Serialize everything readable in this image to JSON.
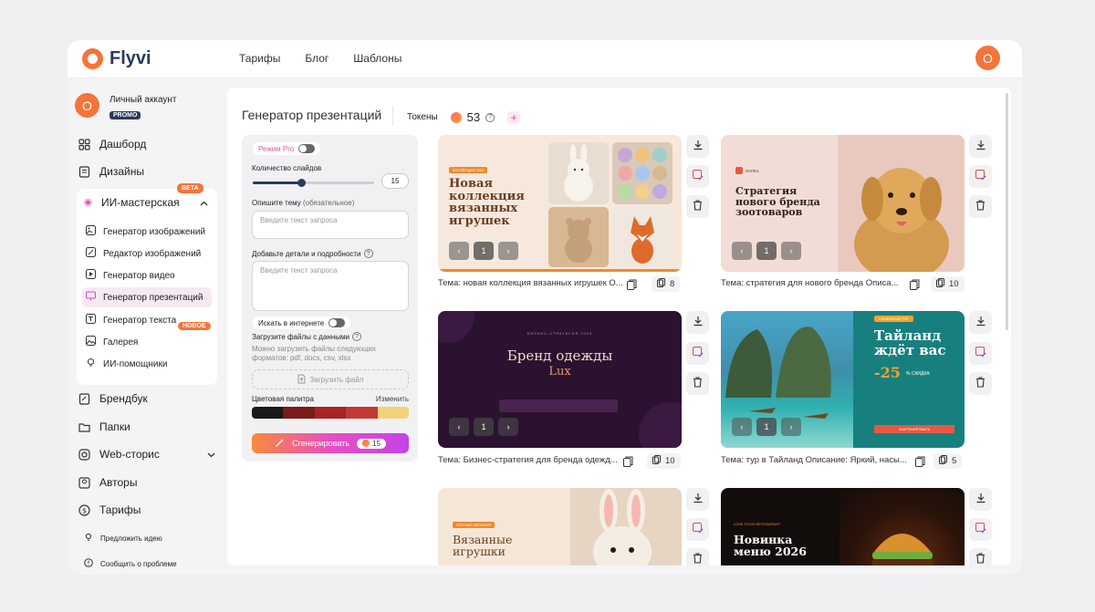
{
  "app": {
    "name": "Flyvi",
    "user_initial": "O"
  },
  "nav": [
    "Тарифы",
    "Блог",
    "Шаблоны"
  ],
  "account": {
    "name": "Личный аккаунт",
    "badge": "PROMO",
    "initial": "O"
  },
  "sidebar": {
    "dashboard": "Дашборд",
    "designs": "Дизайны",
    "ai_studio": {
      "label": "ИИ-мастерская",
      "badge": "BETA"
    },
    "sub_items": [
      "Генератор изображений",
      "Редактор изображений",
      "Генератор видео",
      "Генератор презентаций",
      "Генератор текста",
      "Галерея",
      "ИИ-помощники"
    ],
    "active_badge": "НОВОЕ",
    "brandbook": "Брендбук",
    "folders": "Папки",
    "web_stories": "Web-сторис",
    "authors": "Авторы",
    "tariffs": "Тарифы",
    "suggest": "Предложить идею",
    "report": "Сообщить о проблеме"
  },
  "header": {
    "title": "Генератор презентаций",
    "tokens_label": "Токены",
    "tokens_value": "53",
    "help": "?",
    "add": "+"
  },
  "form": {
    "pro_mode": "Режим Pro",
    "slides_label": "Количество слайдов",
    "slides_value": "15",
    "slides_fraction": 0.4,
    "topic_label": "Опишите тему",
    "topic_required": "(обязательное)",
    "topic_placeholder": "Введите текст запроса",
    "details_label": "Добавьте детали и подробности",
    "details_placeholder": "Введите текст запроса",
    "internet_label": "Искать в интернете",
    "upload_label": "Загрузите файлы с данными",
    "upload_hint": "Можно загрузить файлы следующих форматов: pdf, docs, csv, xlsx",
    "upload_button": "Загрузить файл",
    "palette_label": "Цветовая палитра",
    "palette_change": "Изменить",
    "palette": [
      "#1a1a1a",
      "#7a1a1a",
      "#a82424",
      "#c33a35",
      "#f2d27a"
    ],
    "generate": "Сгенерировать",
    "generate_cost": "15"
  },
  "cards": [
    {
      "title": "Тема: новая коллекция вязанных игрушек О...",
      "slides": "8",
      "page": "1",
      "tag": "КОЛЛЕКЦИЯ 2026",
      "heading": "Новая коллекция вязанных игрушек",
      "colors": {
        "bg": "#f6e8dc",
        "accent": "#f08a2c"
      }
    },
    {
      "title": "Тема: стратегия для нового бренда Описа...",
      "slides": "10",
      "page": "1",
      "tag": "ЛАПКА",
      "heading": "Стратегия нового бренда зоотоваров",
      "colors": {
        "bg": "#f2ddd6",
        "accent": "#f08a2c"
      }
    },
    {
      "title": "Тема: Бизнес-стратегия для бренда одежд...",
      "slides": "10",
      "page": "1",
      "tag": "БИЗНЕС-СТРАТЕГИЯ 2026",
      "heading": "Бренд одежды",
      "heading2": "Lux",
      "colors": {
        "bg": "#2a1230",
        "accent": "#e79a6a"
      }
    },
    {
      "title": "Тема: тур в Тайланд Описание: Яркий, насы...",
      "slides": "5",
      "page": "1",
      "tag": "СЕМЕЙНЫЙ ТУР",
      "heading": "Тайланд ждёт вас",
      "discount": "-25",
      "discount_unit": "% СКИДКА",
      "cta": "ЗАБРОНИРОВАТЬ",
      "colors": {
        "bg": "#17807f",
        "accent": "#f3a32b"
      }
    },
    {
      "title": "",
      "slides": "",
      "page": "",
      "tag": "УЮТНЫЕ ВЯЗАНИЯ",
      "heading": "Вязанные игрушки",
      "colors": {
        "bg": "#f5e7d8",
        "accent": "#f08a2c"
      }
    },
    {
      "title": "",
      "slides": "",
      "page": "",
      "tag": "LOVE FOOD RESTAURANT",
      "heading": "Новинка меню 2026",
      "colors": {
        "bg": "#120d0a",
        "accent": "#f08a2c"
      }
    }
  ]
}
